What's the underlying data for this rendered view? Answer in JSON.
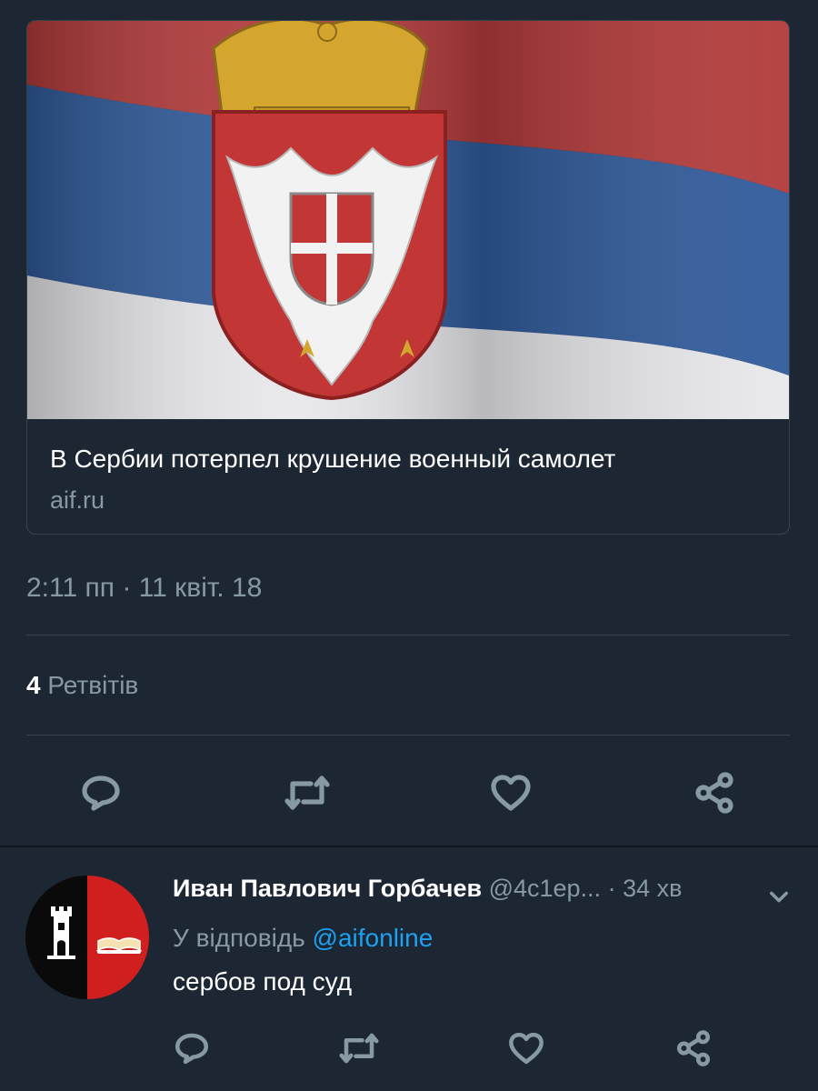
{
  "card": {
    "image_description": "flag-of-serbia",
    "title": "В Сербии потерпел крушение военный самолет",
    "domain": "aif.ru"
  },
  "tweet": {
    "timestamp": "2:11 пп · 11 квіт. 18",
    "retweet_count": "4",
    "retweet_label": "Ретвітів"
  },
  "reply": {
    "name": "Иван Павлович Горбачев",
    "handle": "@4c1ep...",
    "time": "· 34 хв",
    "reply_prefix": "У відповідь",
    "reply_mention": "@aifonline",
    "text": "сербов под суд"
  },
  "colors": {
    "background": "#1c2733",
    "secondary_text": "#8899a6",
    "link": "#1da1f2",
    "border": "#38444d"
  },
  "icons": {
    "actions": [
      "reply-icon",
      "retweet-icon",
      "like-icon",
      "share-icon"
    ],
    "caret": "chevron-down-icon"
  }
}
